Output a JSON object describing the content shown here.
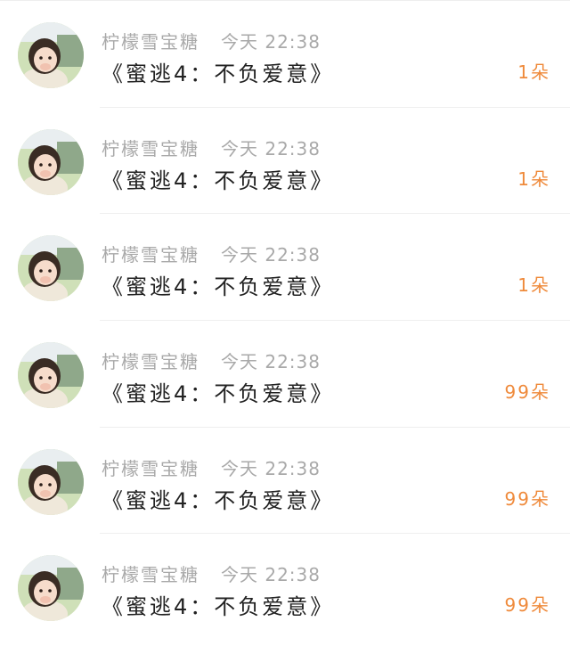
{
  "records": [
    {
      "name": "柠檬雪宝糖",
      "time": "今天 22:38",
      "title": "《蜜逃4：不负爱意》",
      "gift": "1朵",
      "avatar_icon": "girl-avatar-icon"
    },
    {
      "name": "柠檬雪宝糖",
      "time": "今天 22:38",
      "title": "《蜜逃4：不负爱意》",
      "gift": "1朵",
      "avatar_icon": "girl-avatar-icon"
    },
    {
      "name": "柠檬雪宝糖",
      "time": "今天 22:38",
      "title": "《蜜逃4：不负爱意》",
      "gift": "1朵",
      "avatar_icon": "girl-avatar-icon"
    },
    {
      "name": "柠檬雪宝糖",
      "time": "今天 22:38",
      "title": "《蜜逃4：不负爱意》",
      "gift": "99朵",
      "avatar_icon": "girl-avatar-icon"
    },
    {
      "name": "柠檬雪宝糖",
      "time": "今天 22:38",
      "title": "《蜜逃4：不负爱意》",
      "gift": "99朵",
      "avatar_icon": "girl-avatar-icon"
    },
    {
      "name": "柠檬雪宝糖",
      "time": "今天 22:38",
      "title": "《蜜逃4：不负爱意》",
      "gift": "99朵",
      "avatar_icon": "girl-avatar-icon"
    }
  ],
  "colors": {
    "name_text": "#a9a9a9",
    "title_text": "#222222",
    "gift_text": "#ef8a3b",
    "divider": "#efefef"
  }
}
